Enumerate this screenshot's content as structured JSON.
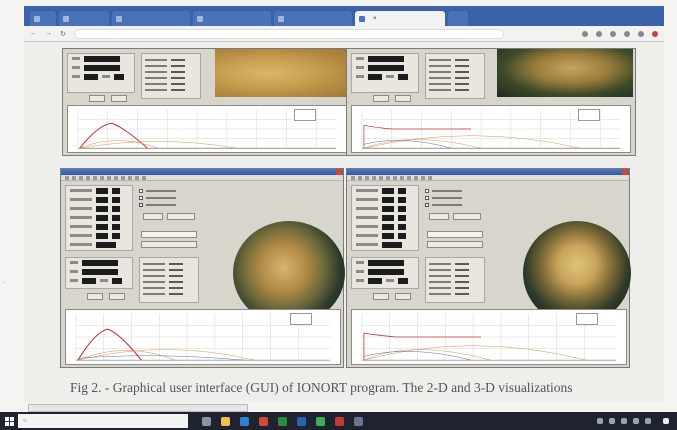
{
  "browser": {
    "tabs": [
      {
        "label": "",
        "active": false
      },
      {
        "label": "",
        "active": false
      },
      {
        "label": "",
        "active": false
      },
      {
        "label": "",
        "active": false
      },
      {
        "label": "",
        "active": false
      },
      {
        "label": "",
        "active": true
      },
      {
        "label": "",
        "active": false
      }
    ],
    "address": ""
  },
  "figure": {
    "caption": "Fig 2. - Graphical user interface (GUI) of IONORT program. The 2-D and 3-D visualizations"
  },
  "taskbar": {
    "search_placeholder": "",
    "clock_time": "",
    "clock_date": ""
  },
  "colors": {
    "tab_strip": "#3b62a8",
    "taskbar": "#1f2330",
    "plot_red": "#c8302e",
    "plot_orange": "#e0904a",
    "plot_blue": "#4a6bb8"
  },
  "icons": [
    "back-icon",
    "forward-icon",
    "reload-icon",
    "windows-start-icon",
    "search-icon"
  ]
}
